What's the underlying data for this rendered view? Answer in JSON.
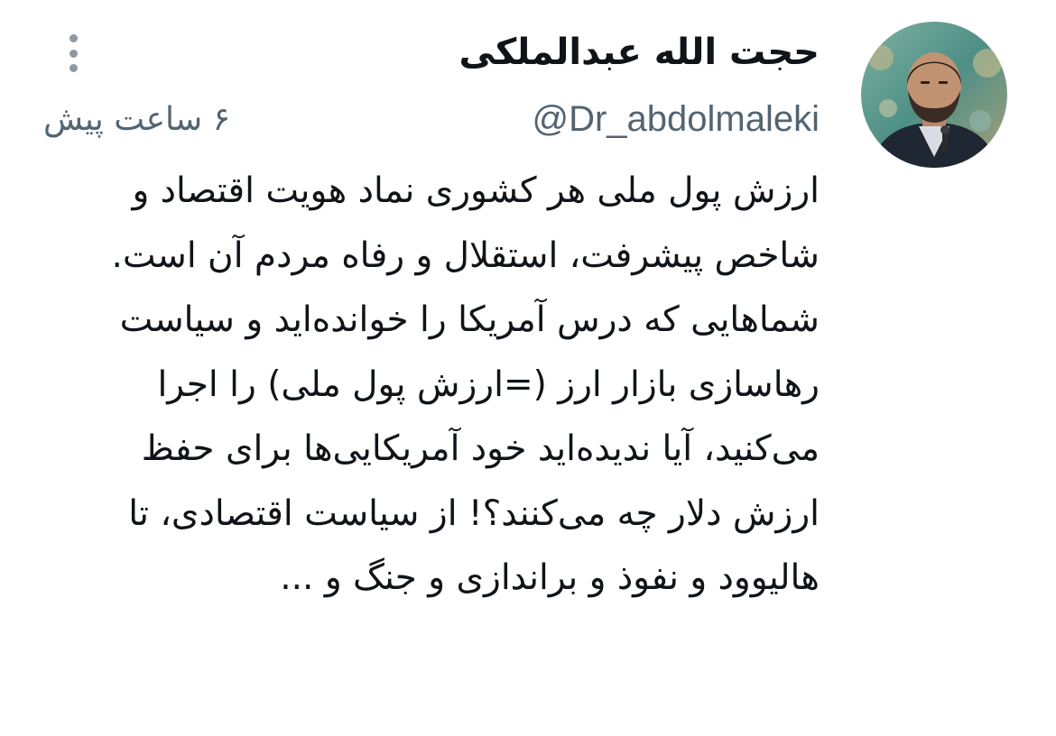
{
  "tweet": {
    "author": {
      "display_name": "حجت الله عبدالملکی",
      "handle": "@Dr_abdolmaleki",
      "avatar_icon": "profile-photo"
    },
    "timestamp": "۶ ساعت پیش",
    "more_icon": "more-vertical-icon",
    "body": {
      "paragraph_1": "ارزش پول ملی هر کشوری نماد هویت اقتصاد و شاخص پیشرفت، استقلال و رفاه مردم آن است.",
      "paragraph_2": "شماهایی که درس آمریکا را خوانده‌اید و سیاست رهاسازی بازار ارز (=ارزش پول ملی) را اجرا می‌کنید، آیا ندیده‌اید خود آمریکایی‌ها برای حفظ ارزش دلار چه می‌کنند؟! از سیاست اقتصادی، تا هالیوود و نفوذ و براندازی و جنگ و ..."
    },
    "colors": {
      "text": "#0f1419",
      "secondary": "#536471",
      "icon": "#8b98a5",
      "background": "#ffffff"
    }
  }
}
